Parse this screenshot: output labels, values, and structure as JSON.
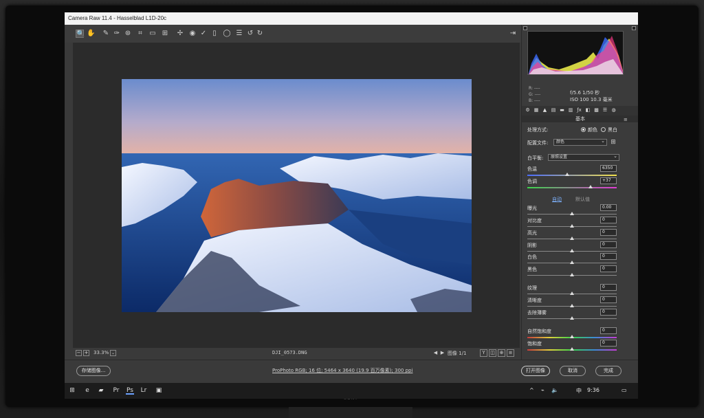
{
  "window": {
    "title": "Camera Raw 11.4 - Hasselblad L1D-20c"
  },
  "monitor": {
    "brand": "SONY"
  },
  "toolbar": {
    "tools": [
      {
        "name": "zoom-tool",
        "icon": "🔍",
        "active": true
      },
      {
        "name": "hand-tool",
        "icon": "✋"
      },
      {
        "name": "white-balance-tool",
        "icon": "✎"
      },
      {
        "name": "color-sampler-tool",
        "icon": "✑"
      },
      {
        "name": "target-adjust-tool",
        "icon": "⊛"
      },
      {
        "name": "crop-tool",
        "icon": "⌗"
      },
      {
        "name": "straighten-tool",
        "icon": "▭"
      },
      {
        "name": "transform-tool",
        "icon": "⊞"
      },
      {
        "name": "spot-removal-tool",
        "icon": "✢"
      },
      {
        "name": "red-eye-tool",
        "icon": "◉"
      },
      {
        "name": "adjustment-brush-tool",
        "icon": "✓"
      },
      {
        "name": "graduated-filter-tool",
        "icon": "▯"
      },
      {
        "name": "radial-filter-tool",
        "icon": "◯"
      },
      {
        "name": "preferences-tool",
        "icon": "☰"
      },
      {
        "name": "rotate-left-tool",
        "icon": "↺"
      },
      {
        "name": "rotate-right-tool",
        "icon": "↻"
      }
    ],
    "open_icon": "⇥"
  },
  "bottom": {
    "zoom_minus": "−",
    "zoom_plus": "+",
    "zoom": "33.3%",
    "zoom_dd": "⌄",
    "filename": "DJI_0573.DNG",
    "prev": "◀",
    "next": "▶",
    "image_count": "图像 1/1",
    "view_y": "Y",
    "view_2": "◫",
    "view_3": "⊕",
    "view_4": "≡"
  },
  "footer": {
    "save_label": "存储图像...",
    "workflow": "ProPhoto RGB; 16 位; 5464 x 3640 (19.9 百万像素); 300 ppi",
    "open_label": "打开图像",
    "cancel_label": "取消",
    "done_label": "完成"
  },
  "readout": {
    "r": "R:  ----",
    "g": "G:  ----",
    "b": "B:  ----"
  },
  "camera_info": {
    "line1": "f/5.6   1/50 秒",
    "line2": "ISO 100   10.3 毫米"
  },
  "panel": {
    "title": "基本",
    "menu": "≡",
    "tabs": [
      "⚙",
      "▦",
      "▲",
      "▤",
      "▬",
      "▥",
      "ƒx",
      "◧",
      "▩",
      "☰",
      "◍"
    ],
    "process_label": "处理方式:",
    "color_label": "颜色",
    "bw_label": "黑白",
    "profile_label": "配置文件:",
    "profile_value": "颜色",
    "profile_grid": "⊞",
    "wb_label": "白平衡:",
    "wb_value": "原照设置",
    "temp_label": "色温",
    "temp_value": "6350",
    "tint_label": "色调",
    "tint_value": "+37",
    "auto_label": "自动",
    "default_label": "默认值",
    "sliders": [
      {
        "label": "曝光",
        "value": "0.00"
      },
      {
        "label": "对比度",
        "value": "0"
      },
      {
        "label": "高光",
        "value": "0"
      },
      {
        "label": "阴影",
        "value": "0"
      },
      {
        "label": "白色",
        "value": "0"
      },
      {
        "label": "黑色",
        "value": "0"
      },
      {
        "label": "纹理",
        "value": "0"
      },
      {
        "label": "清晰度",
        "value": "0"
      },
      {
        "label": "去除薄雾",
        "value": "0"
      },
      {
        "label": "自然饱和度",
        "value": "0"
      },
      {
        "label": "饱和度",
        "value": "0"
      }
    ]
  },
  "taskbar": {
    "apps": [
      {
        "name": "windows-start-icon",
        "icon": "⊞"
      },
      {
        "name": "edge-icon",
        "icon": "e"
      },
      {
        "name": "file-explorer-icon",
        "icon": "▰"
      },
      {
        "name": "premiere-icon",
        "icon": "Pr"
      },
      {
        "name": "photoshop-icon",
        "icon": "Ps",
        "active": true
      },
      {
        "name": "lightroom-icon",
        "icon": "Lr"
      },
      {
        "name": "photos-icon",
        "icon": "▣"
      }
    ],
    "tray": {
      "arrow": "^",
      "network": "⌁",
      "volume": "🔈",
      "ime": "中",
      "time": "9:36",
      "notify": "▭"
    }
  },
  "colors": {
    "accent": "#6aa0ff",
    "panel": "#3b3b3b"
  }
}
